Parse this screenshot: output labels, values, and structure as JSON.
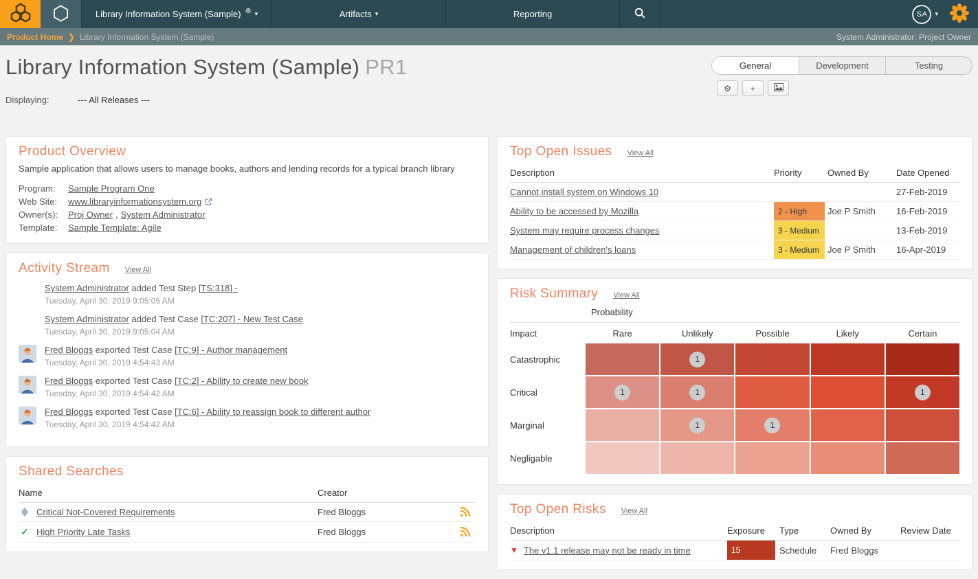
{
  "icons": {
    "caret_down": "▾",
    "gear": "⚙",
    "plus": "+",
    "breadcrumb_chevron": "❯",
    "check": "✓",
    "risk_triangle": "▼"
  },
  "colors": {
    "accent": "#F2835F",
    "topbar": "#2C4A53",
    "logo_orange": "#F9A11B",
    "priority_high": "#F0914E",
    "priority_medium": "#F6D44D",
    "exposure_high": "#B93A23"
  },
  "topnav": {
    "product_menu": "Library Information System (Sample)",
    "artifacts": "Artifacts",
    "reporting": "Reporting",
    "avatar_initials": "SA"
  },
  "breadcrumb": {
    "home": "Product Home",
    "current": "Library Information System (Sample)",
    "user_role": "System Administrator: Project Owner"
  },
  "header": {
    "title": "Library Information System (Sample)",
    "product_code": "PR1",
    "tabs": [
      {
        "label": "General",
        "active": true
      },
      {
        "label": "Development",
        "active": false
      },
      {
        "label": "Testing",
        "active": false
      }
    ],
    "displaying_label": "Displaying:",
    "displaying_value": "--- All Releases ---"
  },
  "product_overview": {
    "title": "Product Overview",
    "description": "Sample application that allows users to manage books, authors and lending records for a typical branch library",
    "program_label": "Program:",
    "program_value": "Sample Program One",
    "website_label": "Web Site:",
    "website_value": "www.libraryinformationsystem.org",
    "owners_label": "Owner(s):",
    "owner1": "Proj Owner",
    "owners_separator": ",",
    "owner2": "System Administrator",
    "template_label": "Template:",
    "template_value": "Sample Template: Agile"
  },
  "activity": {
    "title": "Activity Stream",
    "view_all": "View All",
    "items": [
      {
        "user": "System Administrator",
        "action": "added Test Step",
        "target": "[TS:318] -",
        "date": "Tuesday, April 30, 2019 9:05:05 AM"
      },
      {
        "user": "System Administrator",
        "action": "added Test Case",
        "target": "[TC:207] - New Test Case",
        "date": "Tuesday, April 30, 2019 9:05:04 AM"
      },
      {
        "user": "Fred Bloggs",
        "action": "exported Test Case",
        "target": "[TC:9] - Author management",
        "date": "Tuesday, April 30, 2019 4:54:43 AM"
      },
      {
        "user": "Fred Bloggs",
        "action": "exported Test Case",
        "target": "[TC:2] - Ability to create new book",
        "date": "Tuesday, April 30, 2019 4:54:42 AM"
      },
      {
        "user": "Fred Bloggs",
        "action": "exported Test Case",
        "target": "[TC:6] - Ability to reassign book to different author",
        "date": "Tuesday, April 30, 2019 4:54:42 AM"
      }
    ]
  },
  "shared_searches": {
    "title": "Shared Searches",
    "columns": [
      "Name",
      "Creator"
    ],
    "rows": [
      {
        "icon": "requirement-diamond",
        "name": "Critical Not-Covered Requirements",
        "creator": "Fred Bloggs"
      },
      {
        "icon": "task-check",
        "name": "High Priority Late Tasks",
        "creator": "Fred Bloggs"
      }
    ]
  },
  "top_open_issues": {
    "title": "Top Open Issues",
    "view_all": "View All",
    "columns": [
      "Description",
      "Priority",
      "Owned By",
      "Date Opened"
    ],
    "rows": [
      {
        "description": "Cannot install system on Windows 10",
        "priority": "",
        "priority_color": "",
        "owned_by": "",
        "date_opened": "27-Feb-2019"
      },
      {
        "description": "Ability to be accessed by Mozilla",
        "priority": "2 - High",
        "priority_color": "#F0914E",
        "owned_by": "Joe P Smith",
        "date_opened": "16-Feb-2019"
      },
      {
        "description": "System may require process changes",
        "priority": "3 - Medium",
        "priority_color": "#F6D44D",
        "owned_by": "",
        "date_opened": "13-Feb-2019"
      },
      {
        "description": "Management of children's loans",
        "priority": "3 - Medium",
        "priority_color": "#F6D44D",
        "owned_by": "Joe P Smith",
        "date_opened": "16-Apr-2019"
      }
    ]
  },
  "risk_summary": {
    "title": "Risk Summary",
    "view_all": "View All",
    "probability_label": "Probability",
    "impact_label": "Impact",
    "columns": [
      "Rare",
      "Unlikely",
      "Possible",
      "Likely",
      "Certain"
    ],
    "rows": [
      {
        "label": "Catastrophic",
        "cells": [
          {
            "color": "#C4695C",
            "count": ""
          },
          {
            "color": "#C05746",
            "count": "1"
          },
          {
            "color": "#C24734",
            "count": ""
          },
          {
            "color": "#BE3826",
            "count": ""
          },
          {
            "color": "#A62C19",
            "count": ""
          }
        ]
      },
      {
        "label": "Critical",
        "cells": [
          {
            "color": "#DD9186",
            "count": "1"
          },
          {
            "color": "#DA7E6E",
            "count": "1"
          },
          {
            "color": "#DF5B42",
            "count": ""
          },
          {
            "color": "#DD4E33",
            "count": ""
          },
          {
            "color": "#C23A25",
            "count": "1"
          }
        ]
      },
      {
        "label": "Marginal",
        "cells": [
          {
            "color": "#E9AFA5",
            "count": ""
          },
          {
            "color": "#E59788",
            "count": "1"
          },
          {
            "color": "#E47E6A",
            "count": "1"
          },
          {
            "color": "#E2614B",
            "count": ""
          },
          {
            "color": "#CB4F39",
            "count": ""
          }
        ]
      },
      {
        "label": "Negligable",
        "cells": [
          {
            "color": "#F1C7BF",
            "count": ""
          },
          {
            "color": "#EEB5AA",
            "count": ""
          },
          {
            "color": "#EBA291",
            "count": ""
          },
          {
            "color": "#E78D78",
            "count": ""
          },
          {
            "color": "#CE6A55",
            "count": ""
          }
        ]
      }
    ]
  },
  "top_open_risks": {
    "title": "Top Open Risks",
    "view_all": "View All",
    "columns": [
      "Description",
      "Exposure",
      "Type",
      "Owned By",
      "Review Date"
    ],
    "rows": [
      {
        "description": "The v1.1 release may not be ready in time",
        "exposure": "15",
        "exposure_color": "#B93A23",
        "type": "Schedule",
        "owned_by": "Fred Bloggs",
        "review_date": ""
      }
    ]
  }
}
